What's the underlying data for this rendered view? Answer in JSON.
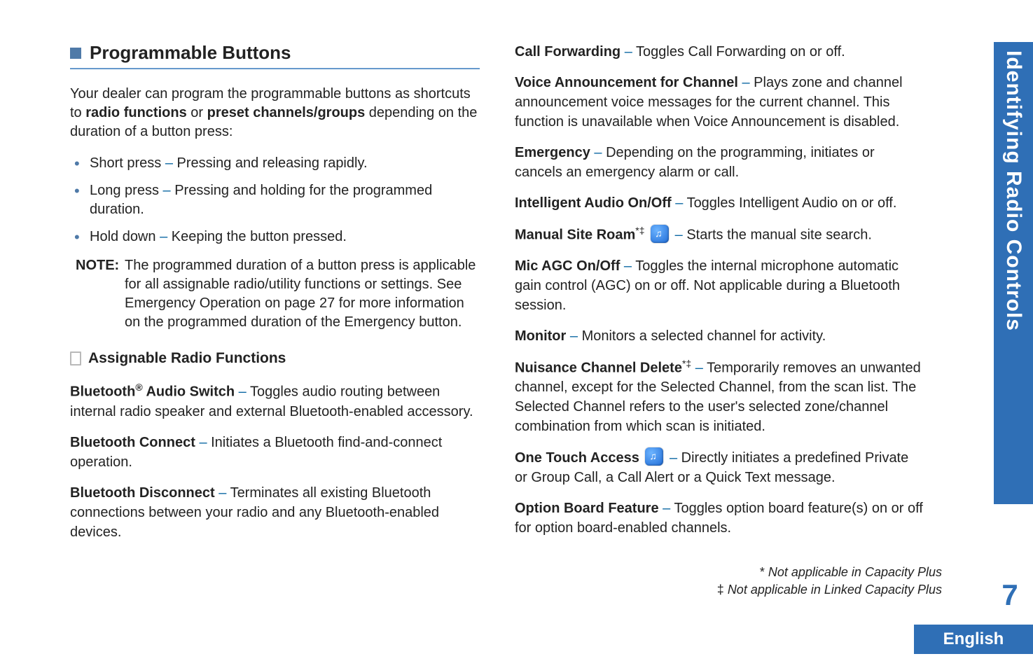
{
  "section": {
    "title": "Programmable Buttons",
    "intro_pre": "Your dealer can program the programmable buttons as shortcuts to ",
    "intro_b1": "radio functions",
    "intro_mid": " or ",
    "intro_b2": "preset channels/groups",
    "intro_post": " depending on the duration of a button press:"
  },
  "bullets": {
    "b1_pre": "Short press ",
    "b1_dash": "– ",
    "b1_post": "Pressing and releasing rapidly.",
    "b2_pre": "Long press ",
    "b2_dash": "– ",
    "b2_post": "Pressing and holding for the programmed duration.",
    "b3_pre": "Hold down ",
    "b3_dash": "– ",
    "b3_post": "Keeping the button pressed."
  },
  "note": {
    "label": "NOTE:",
    "text_pre": "The programmed duration of a button press is applicable for all assignable radio/utility functions or settings. See ",
    "text_bi": "Emergency Operation",
    "text_mid": " on page 27 for more information on the programmed duration of the ",
    "text_b": "Emergency",
    "text_post": " button."
  },
  "sub": {
    "title": "Assignable Radio Functions"
  },
  "fns_left": {
    "f1_b": "Bluetooth",
    "f1_sup": "®",
    "f1_b2": " Audio Switch ",
    "f1_dash": "– ",
    "f1_txt": "Toggles audio routing between internal radio speaker and external Bluetooth-enabled accessory.",
    "f2_b": "Bluetooth Connect ",
    "f2_dash": "– ",
    "f2_txt": "Initiates a Bluetooth find-and-connect operation.",
    "f3_b": "Bluetooth Disconnect ",
    "f3_dash": "– ",
    "f3_txt": "Terminates all existing Bluetooth connections between your radio and any Bluetooth-enabled devices."
  },
  "fns_right": {
    "r1_b": "Call Forwarding ",
    "r1_dash": "– ",
    "r1_txt": "Toggles Call Forwarding on or off.",
    "r2_b": "Voice Announcement for Channel ",
    "r2_dash": "– ",
    "r2_txt": "Plays zone and channel announcement voice messages for the current channel. This function is unavailable when Voice Announcement is disabled.",
    "r3_b": "Emergency ",
    "r3_dash": "– ",
    "r3_txt": "Depending on the programming, initiates or cancels an emergency alarm or call.",
    "r4_b": "Intelligent Audio On/Off ",
    "r4_dash": "– ",
    "r4_txt": "Toggles Intelligent Audio on or off.",
    "r5_b": "Manual Site Roam",
    "r5_sup": "*‡",
    "r5_dash": " – ",
    "r5_txt": "Starts the manual site search.",
    "r6_b": "Mic AGC On/Off ",
    "r6_dash": "– ",
    "r6_txt": "Toggles the internal microphone automatic gain control (AGC) on or off. Not applicable during a Bluetooth session.",
    "r7_b": "Monitor ",
    "r7_dash": "– ",
    "r7_txt": "Monitors a selected channel for activity.",
    "r8_b": "Nuisance Channel Delete",
    "r8_sup": "*‡",
    "r8_dash": " – ",
    "r8_txt": "Temporarily removes an unwanted channel, except for the Selected Channel, from the scan list. The Selected Channel refers to the user's selected zone/channel combination from which scan is initiated.",
    "r9_b": "One Touch Access ",
    "r9_dash": " – ",
    "r9_txt": "Directly initiates a predefined Private or Group Call, a Call Alert or a Quick Text message.",
    "r10_b": "Option Board Feature ",
    "r10_dash": "– ",
    "r10_txt": "Toggles option board feature(s) on or off for option board-enabled channels."
  },
  "footnotes": {
    "f1_pre": "* ",
    "f1_txt": "Not applicable in Capacity Plus",
    "f2_pre": "‡ ",
    "f2_txt": "Not applicable in Linked Capacity Plus"
  },
  "side": {
    "tab": "Identifying Radio Controls",
    "pagenum": "7",
    "lang": "English"
  }
}
